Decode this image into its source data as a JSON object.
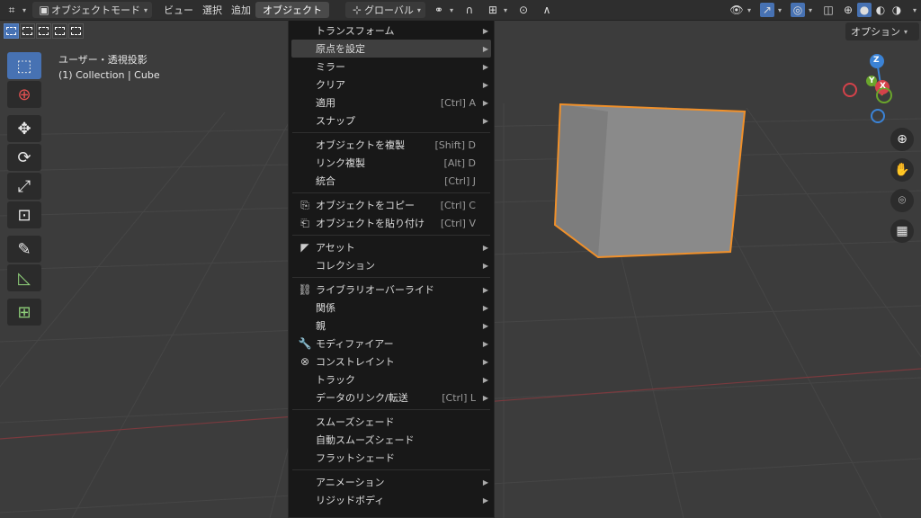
{
  "header": {
    "mode_label": "オブジェクトモード",
    "menus": [
      "ビュー",
      "選択",
      "追加",
      "オブジェクト"
    ],
    "transform_orientation": "グローバル"
  },
  "subbar": {
    "options_label": "オプション"
  },
  "viewport": {
    "view_name": "ユーザー・透視投影",
    "collection_info": "(1) Collection | Cube",
    "gizmo": {
      "z": "Z",
      "y": "Y",
      "x": "X"
    }
  },
  "menu": {
    "items": [
      {
        "label": "トランスフォーム",
        "shortcut": "",
        "submenu": true,
        "icon": ""
      },
      {
        "label": "原点を設定",
        "shortcut": "",
        "submenu": true,
        "icon": "",
        "highlight": true
      },
      {
        "label": "ミラー",
        "shortcut": "",
        "submenu": true,
        "icon": ""
      },
      {
        "label": "クリア",
        "shortcut": "",
        "submenu": true,
        "icon": ""
      },
      {
        "label": "適用",
        "shortcut": "[Ctrl] A",
        "submenu": true,
        "icon": ""
      },
      {
        "label": "スナップ",
        "shortcut": "",
        "submenu": true,
        "icon": "",
        "sep_after": true
      },
      {
        "label": "オブジェクトを複製",
        "shortcut": "[Shift] D",
        "submenu": false,
        "icon": ""
      },
      {
        "label": "リンク複製",
        "shortcut": "[Alt] D",
        "submenu": false,
        "icon": ""
      },
      {
        "label": "統合",
        "shortcut": "[Ctrl] J",
        "submenu": false,
        "icon": "",
        "sep_after": true
      },
      {
        "label": "オブジェクトをコピー",
        "shortcut": "[Ctrl] C",
        "submenu": false,
        "icon": "copy-icon"
      },
      {
        "label": "オブジェクトを貼り付け",
        "shortcut": "[Ctrl] V",
        "submenu": false,
        "icon": "paste-icon",
        "sep_after": true
      },
      {
        "label": "アセット",
        "shortcut": "",
        "submenu": true,
        "icon": "asset-icon"
      },
      {
        "label": "コレクション",
        "shortcut": "",
        "submenu": true,
        "icon": "",
        "sep_after": true
      },
      {
        "label": "ライブラリオーバーライド",
        "shortcut": "",
        "submenu": true,
        "icon": "library-override-icon"
      },
      {
        "label": "関係",
        "shortcut": "",
        "submenu": true,
        "icon": ""
      },
      {
        "label": "親",
        "shortcut": "",
        "submenu": true,
        "icon": ""
      },
      {
        "label": "モディファイアー",
        "shortcut": "",
        "submenu": true,
        "icon": "wrench-icon"
      },
      {
        "label": "コンストレイント",
        "shortcut": "",
        "submenu": true,
        "icon": "constraint-icon"
      },
      {
        "label": "トラック",
        "shortcut": "",
        "submenu": true,
        "icon": ""
      },
      {
        "label": "データのリンク/転送",
        "shortcut": "[Ctrl] L",
        "submenu": true,
        "icon": "",
        "sep_after": true
      },
      {
        "label": "スムーズシェード",
        "shortcut": "",
        "submenu": false,
        "icon": ""
      },
      {
        "label": "自動スムーズシェード",
        "shortcut": "",
        "submenu": false,
        "icon": ""
      },
      {
        "label": "フラットシェード",
        "shortcut": "",
        "submenu": false,
        "icon": "",
        "sep_after": true
      },
      {
        "label": "アニメーション",
        "shortcut": "",
        "submenu": true,
        "icon": ""
      },
      {
        "label": "リジッドボディ",
        "shortcut": "",
        "submenu": true,
        "icon": ""
      }
    ]
  },
  "colors": {
    "accent": "#4772b3",
    "selection_outline": "#f0902a",
    "axis_x": "#d4424a",
    "axis_y": "#6aa52c",
    "axis_z": "#3b83d6"
  }
}
